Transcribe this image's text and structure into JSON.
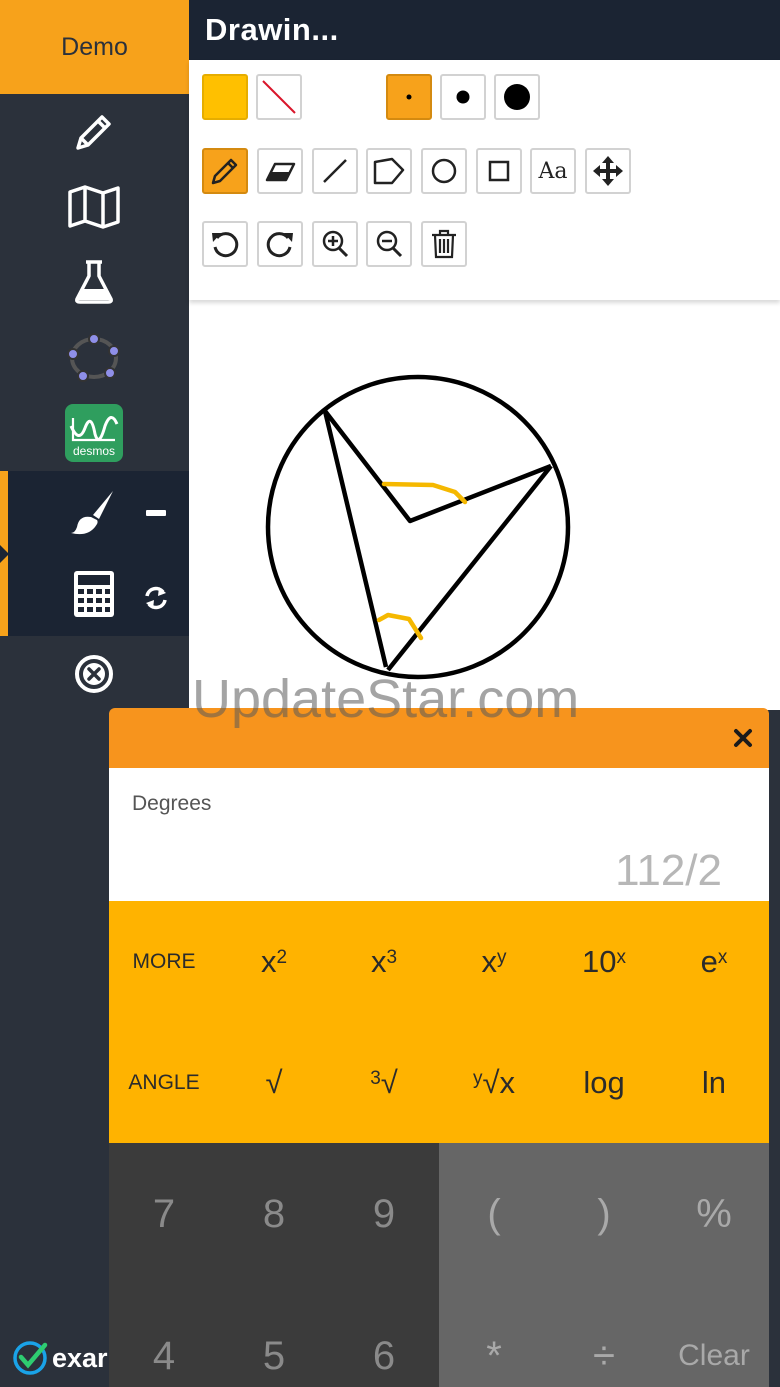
{
  "sidebar": {
    "demo_label": "Demo",
    "items": [
      {
        "name": "pencil-icon"
      },
      {
        "name": "map-icon"
      },
      {
        "name": "flask-icon"
      },
      {
        "name": "geogebra-icon"
      },
      {
        "name": "desmos-icon",
        "label": "desmos"
      },
      {
        "name": "paintbrush-icon"
      },
      {
        "name": "calculator-icon"
      },
      {
        "name": "close-circle-icon"
      }
    ],
    "logo_text": "exar"
  },
  "drawing": {
    "title": "Drawin...",
    "colors": {
      "fill": "#ffc000",
      "accent": "#f7a21b",
      "stroke": "#000000",
      "highlight": "#f5b800"
    },
    "toolbar_rows": [
      [
        "fill-color",
        "no-stroke",
        "size-small",
        "size-medium",
        "size-large"
      ],
      [
        "pencil",
        "eraser",
        "line",
        "polygon",
        "circle",
        "rectangle",
        "text",
        "move"
      ],
      [
        "undo",
        "redo",
        "zoom-in",
        "zoom-out",
        "delete"
      ]
    ],
    "text_tool_label": "Aa"
  },
  "watermark": "UpdateStar.com",
  "calculator": {
    "mode": "Degrees",
    "expression": "112/2",
    "sci_row1": [
      {
        "label": "MORE"
      },
      {
        "base": "x",
        "sup": "2"
      },
      {
        "base": "x",
        "sup": "3"
      },
      {
        "base": "x",
        "sup": "y"
      },
      {
        "base": "10",
        "sup": "x"
      },
      {
        "base": "e",
        "sup": "x"
      }
    ],
    "sci_row2": [
      {
        "label": "ANGLE"
      },
      {
        "label": "√"
      },
      {
        "pre": "3",
        "label": "√"
      },
      {
        "pre": "y",
        "label": "√x"
      },
      {
        "label": "log"
      },
      {
        "label": "ln"
      }
    ],
    "digits_row1": [
      "7",
      "8",
      "9"
    ],
    "digits_row2": [
      "4",
      "5",
      "6"
    ],
    "ops_row1": [
      "(",
      ")",
      "%"
    ],
    "ops_row2": [
      "*",
      "÷",
      "Clear"
    ]
  }
}
